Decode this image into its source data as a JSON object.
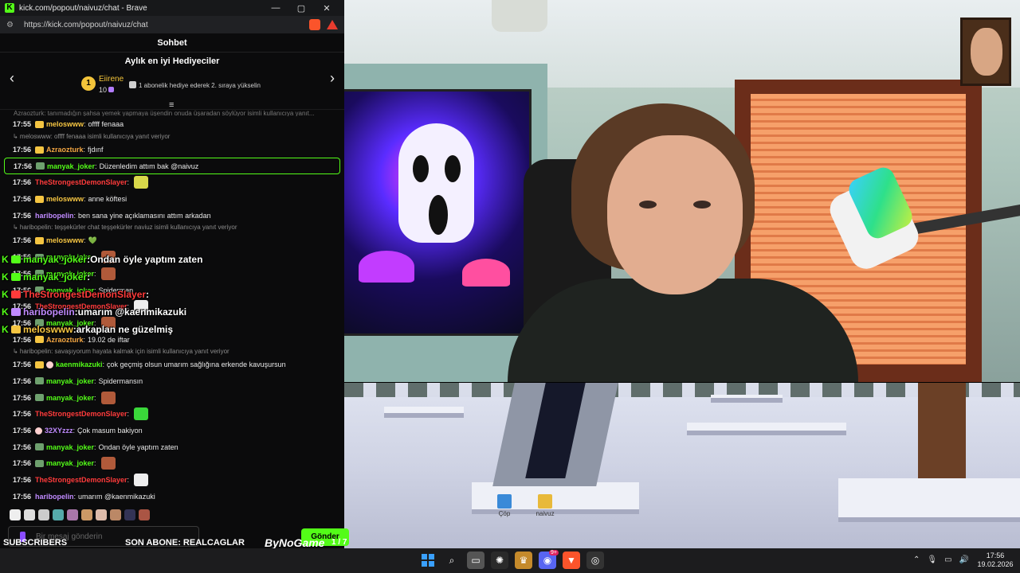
{
  "browser": {
    "title": "kick.com/popout/naivuz/chat - Brave",
    "url": "https://kick.com/popout/naivuz/chat",
    "logo_letter": "K",
    "window_controls": [
      "—",
      "▢",
      "✕"
    ]
  },
  "chat": {
    "header": "Sohbet",
    "gifters": {
      "title": "Aylık en iyi Hediyeciler",
      "rank": "1",
      "name": "Eiirene",
      "count": "10",
      "hint": "1 abonelik hediye ederek 2. sıraya yükselin"
    },
    "truncated_line": "Azraozturk: tanımadığın şahsa yemek yapmaya üşendin onuda üşaradan söylüyor isimli kullanıcıya yanıt...",
    "messages": [
      {
        "type": "msg",
        "time": "17:55",
        "badge": "crown",
        "user": "meloswww",
        "color": "#f5c542",
        "text": "offff fenaaa"
      },
      {
        "type": "reply",
        "text": "↳ meloswww: offff fenaaa isimli kullanıcıya yanıt veriyor"
      },
      {
        "type": "msg",
        "time": "17:56",
        "badge": "crown",
        "user": "Azraozturk",
        "color": "#f5a742",
        "text": "fjdınf"
      },
      {
        "type": "msg",
        "time": "17:56",
        "badge": "tag",
        "user": "manyak_joker",
        "color": "#53fc18",
        "text": "Düzenledim attım bak @naivuz",
        "highlight": true
      },
      {
        "type": "msg",
        "time": "17:56",
        "badge": "",
        "user": "TheStrongestDemonSlayer",
        "color": "#ff3b3b",
        "text": "",
        "emote": "#d8d84a"
      },
      {
        "type": "msg",
        "time": "17:56",
        "badge": "crown",
        "user": "meloswww",
        "color": "#f5c542",
        "text": "anne köftesi"
      },
      {
        "type": "msg",
        "time": "17:56",
        "badge": "",
        "user": "haribopelin",
        "color": "#c08aff",
        "text": "ben sana yine açıklamasını attım arkadan"
      },
      {
        "type": "reply",
        "text": "↳ haribopelin: teşşekürler chat teşşekürler naviuz isimli kullanıcıya yanıt veriyor"
      },
      {
        "type": "msg",
        "time": "17:56",
        "badge": "crown",
        "user": "meloswww",
        "color": "#f5c542",
        "text": "💚"
      },
      {
        "type": "msg",
        "time": "17:56",
        "badge": "tag",
        "user": "manyak_joker",
        "color": "#53fc18",
        "text": "",
        "emote": "#b05a3a"
      },
      {
        "type": "msg",
        "time": "17:56",
        "badge": "tag",
        "user": "manyak_joker",
        "color": "#53fc18",
        "text": "",
        "emote": "#b05a3a"
      },
      {
        "type": "msg",
        "time": "17:56",
        "badge": "tag",
        "user": "manyak_joker",
        "color": "#53fc18",
        "text": "Spiderman"
      },
      {
        "type": "msg",
        "time": "17:56",
        "badge": "",
        "user": "TheStrongestDemonSlayer",
        "color": "#ff3b3b",
        "text": "",
        "emote": "#eeeeee"
      },
      {
        "type": "msg",
        "time": "17:56",
        "badge": "tag",
        "user": "manyak_joker",
        "color": "#53fc18",
        "text": "",
        "emote": "#b05a3a"
      },
      {
        "type": "msg",
        "time": "17:56",
        "badge": "crown",
        "user": "Azraozturk",
        "color": "#f5a742",
        "text": "19.02 de iftar"
      },
      {
        "type": "reply",
        "text": "↳ haribopelin: savaşıyorum hayata kalmak için isimli kullanıcıya yanıt veriyor"
      },
      {
        "type": "msg",
        "time": "17:56",
        "badge": "crown",
        "badge2": "egg",
        "user": "kaenmikazuki",
        "color": "#53fc18",
        "text": "çok geçmiş olsun umarım sağlığına erkende kavuşursun"
      },
      {
        "type": "msg",
        "time": "17:56",
        "badge": "tag",
        "user": "manyak_joker",
        "color": "#53fc18",
        "text": "Spidermansın"
      },
      {
        "type": "msg",
        "time": "17:56",
        "badge": "tag",
        "user": "manyak_joker",
        "color": "#53fc18",
        "text": "",
        "emote": "#b05a3a"
      },
      {
        "type": "msg",
        "time": "17:56",
        "badge": "",
        "user": "TheStrongestDemonSlayer",
        "color": "#ff3b3b",
        "text": "",
        "emote": "#3ad83a"
      },
      {
        "type": "msg",
        "time": "17:56",
        "badge": "egg",
        "user": "32XYzzz",
        "color": "#c08aff",
        "text": "Çok masum bakiyon"
      },
      {
        "type": "msg",
        "time": "17:56",
        "badge": "tag",
        "user": "manyak_joker",
        "color": "#53fc18",
        "text": "Ondan öyle yaptım zaten"
      },
      {
        "type": "msg",
        "time": "17:56",
        "badge": "tag",
        "user": "manyak_joker",
        "color": "#53fc18",
        "text": "",
        "emote": "#b05a3a"
      },
      {
        "type": "msg",
        "time": "17:56",
        "badge": "",
        "user": "TheStrongestDemonSlayer",
        "color": "#ff3b3b",
        "text": "",
        "emote": "#eeeeee"
      },
      {
        "type": "msg",
        "time": "17:56",
        "badge": "",
        "user": "haribopelin",
        "color": "#c08aff",
        "text": "umarım @kaenmikazuki"
      },
      {
        "type": "msg",
        "time": "17:56",
        "badge": "crown",
        "user": "meloswww",
        "color": "#f5c542",
        "text": "arkaplan ne güzelmiş"
      }
    ],
    "overlay": [
      {
        "user": "manyak_joker",
        "color": "#53fc18",
        "text": "Ondan öyle yaptım zaten"
      },
      {
        "user": "manyak_joker",
        "color": "#53fc18",
        "text": ""
      },
      {
        "user": "TheStrongestDemonSlayer",
        "color": "#ff3b3b",
        "text": ""
      },
      {
        "user": "haribopelin",
        "color": "#c08aff",
        "text": "umarım @kaenmikazuki"
      },
      {
        "user": "meloswww",
        "color": "#f5c542",
        "text": "arkaplan ne güzelmiş"
      }
    ],
    "input_placeholder": "Bir mesaj gönderin",
    "send_label": "Gönder"
  },
  "overlay_bar": {
    "subscribers_label": "SUBSCRIBERS",
    "last_sub": "SON ABONE: REALCAGLAR",
    "brand": "ByNoGame",
    "count": "1 / 7",
    "progress": 0.14
  },
  "desktop_icons": [
    {
      "label": "Çöp",
      "color": "#3a8ad8"
    },
    {
      "label": "naivuz",
      "color": "#e8b93a"
    }
  ],
  "taskbar": {
    "time": "17:56",
    "date": "19.02.2026",
    "discord_badge": "9+"
  }
}
